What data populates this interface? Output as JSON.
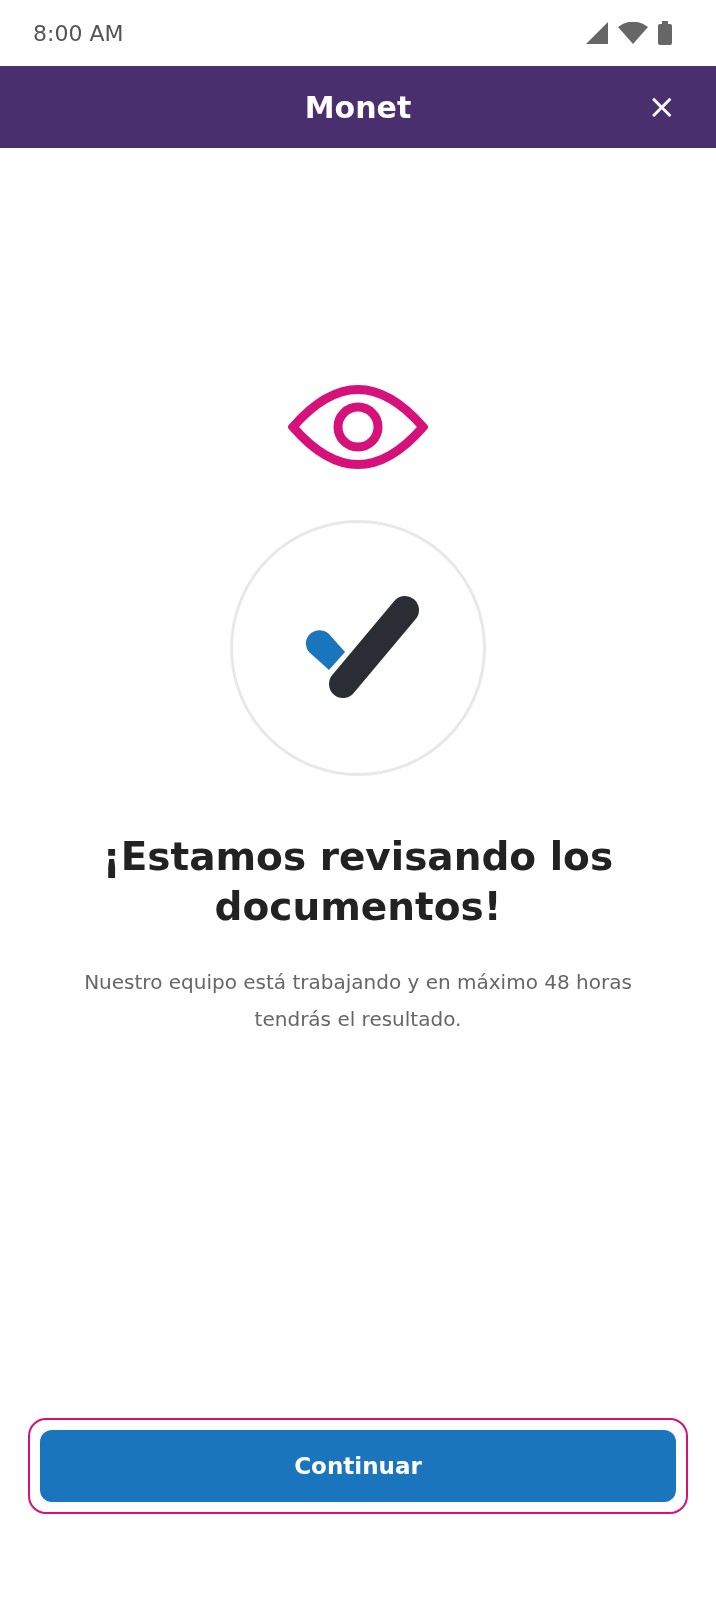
{
  "status_bar": {
    "time": "8:00 AM"
  },
  "app_bar": {
    "title": "Monet",
    "close": "×"
  },
  "content": {
    "heading": "¡Estamos revisando los documentos!",
    "message": "Nuestro equipo está trabajando y en máximo 48 horas tendrás el resultado."
  },
  "button": {
    "label": "Continuar",
    "focused": true
  }
}
